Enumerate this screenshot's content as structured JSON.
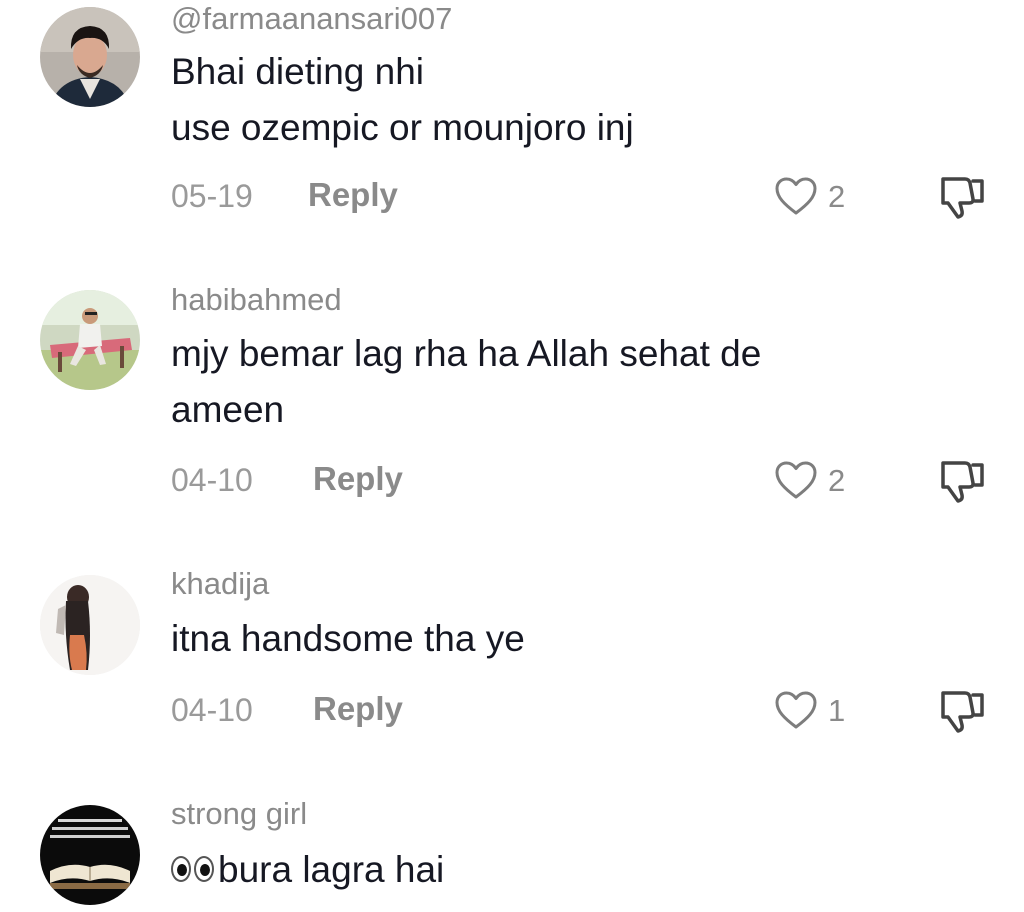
{
  "comments": [
    {
      "username": "@farmaanansari007",
      "text_lines": [
        "Bhai dieting nhi",
        "use ozempic or mounjoro inj"
      ],
      "date": "05-19",
      "reply_label": "Reply",
      "likes": "2",
      "avatar_icon": "man-portrait-avatar"
    },
    {
      "username": "habibahmed",
      "text_lines": [
        "mjy bemar lag rha ha Allah sehat de",
        "ameen"
      ],
      "date": "04-10",
      "reply_label": "Reply",
      "likes": "2",
      "avatar_icon": "man-on-bench-avatar"
    },
    {
      "username": "khadija",
      "text_lines": [
        "itna handsome tha ye"
      ],
      "date": "04-10",
      "reply_label": "Reply",
      "likes": "1",
      "avatar_icon": "girl-silhouette-avatar"
    },
    {
      "username": "strong girl",
      "text_prefix_emoji": "eyes-emoji",
      "text_lines": [
        "bura lagra hai"
      ],
      "avatar_icon": "book-and-text-avatar"
    }
  ],
  "icons": {
    "like": "heart-outline-icon",
    "dislike": "thumbs-down-outline-icon"
  },
  "colors": {
    "username": "#8a8a8a",
    "text": "#161823",
    "meta": "#9a9a9a"
  }
}
